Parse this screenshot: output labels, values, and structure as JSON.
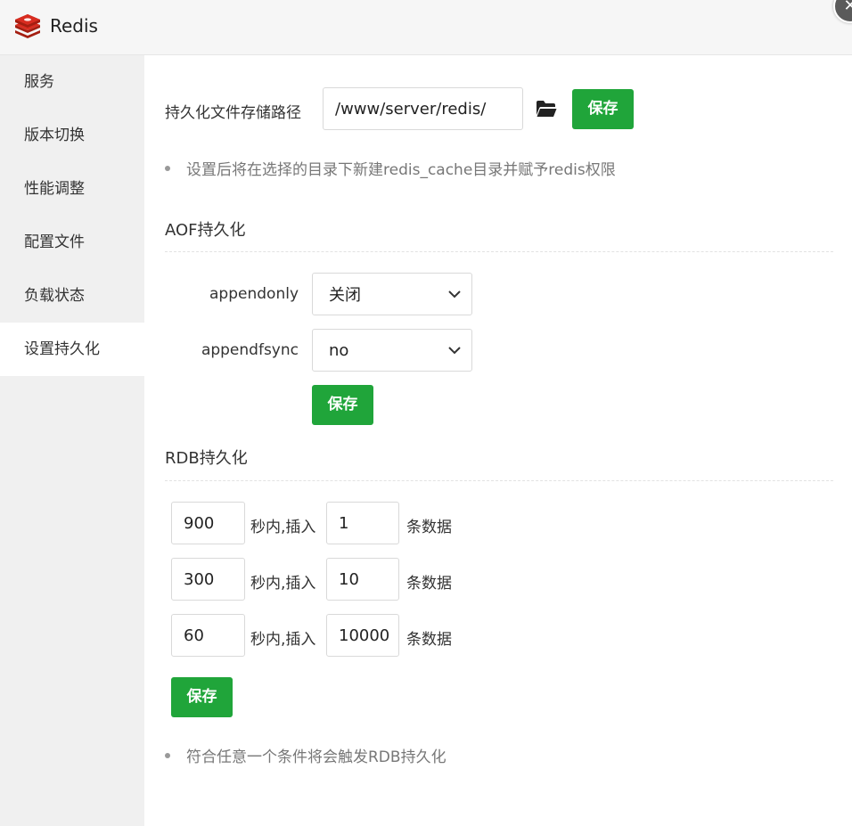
{
  "app": {
    "title": "Redis",
    "close_symbol": "✕"
  },
  "sidebar": {
    "items": [
      {
        "label": "服务"
      },
      {
        "label": "版本切换"
      },
      {
        "label": "性能调整"
      },
      {
        "label": "配置文件"
      },
      {
        "label": "负载状态"
      },
      {
        "label": "设置持久化",
        "active": true
      }
    ]
  },
  "persist_path": {
    "label": "持久化文件存储路径",
    "value": "/www/server/redis/",
    "folder_icon": "folder-open-icon",
    "save_label": "保存",
    "tip": "设置后将在选择的目录下新建redis_cache目录并赋予redis权限"
  },
  "aof": {
    "title": "AOF持久化",
    "appendonly": {
      "label": "appendonly",
      "value": "关闭"
    },
    "appendfsync": {
      "label": "appendfsync",
      "value": "no"
    },
    "save_label": "保存"
  },
  "rdb": {
    "title": "RDB持久化",
    "rows": [
      {
        "seconds": "900",
        "mid_label": "秒内,插入",
        "count": "1",
        "end_label": "条数据"
      },
      {
        "seconds": "300",
        "mid_label": "秒内,插入",
        "count": "10",
        "end_label": "条数据"
      },
      {
        "seconds": "60",
        "mid_label": "秒内,插入",
        "count": "10000",
        "end_label": "条数据"
      }
    ],
    "save_label": "保存",
    "tip": "符合任意一个条件将会触发RDB持久化"
  },
  "colors": {
    "accent": "#20a53a",
    "sidebar_bg": "#f0f0f0",
    "header_bg": "#f6f6f6"
  }
}
